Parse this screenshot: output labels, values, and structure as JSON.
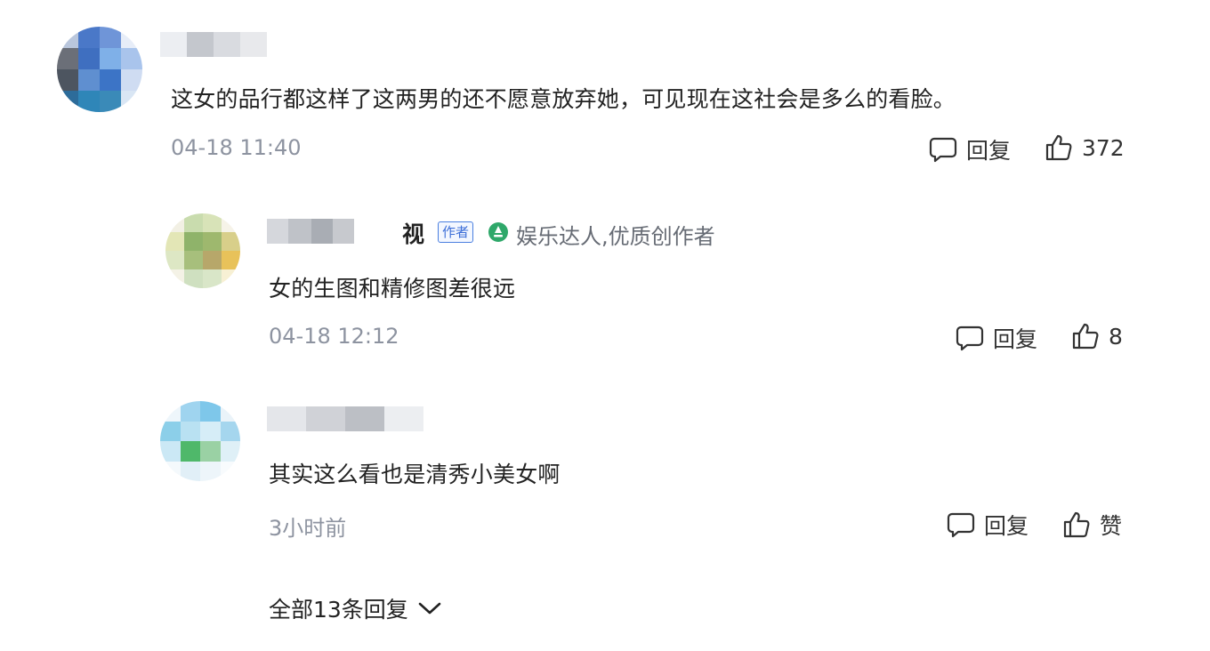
{
  "main_comment": {
    "text": "这女的品行都这样了这两男的还不愿意放弃她，可见现在这社会是多么的看脸。",
    "time": "04-18 11:40",
    "reply_label": "回复",
    "like_count": "372",
    "avatar_icon": "pixelated-avatar"
  },
  "replies": [
    {
      "name_visible": "视",
      "author_badge": "作者",
      "title_badge": "娱乐达人,优质创作者",
      "text": "女的生图和精修图差很远",
      "time": "04-18 12:12",
      "reply_label": "回复",
      "like_count": "8"
    },
    {
      "text": "其实这么看也是清秀小美女啊",
      "time": "3小时前",
      "reply_label": "回复",
      "like_label": "赞"
    }
  ],
  "footer": {
    "all_replies_label": "全部13条回复"
  },
  "colors": {
    "text": "#222222",
    "meta": "#8d93a0",
    "author_badge": "#3d6fd8",
    "level_icon": "#2fa86a"
  }
}
